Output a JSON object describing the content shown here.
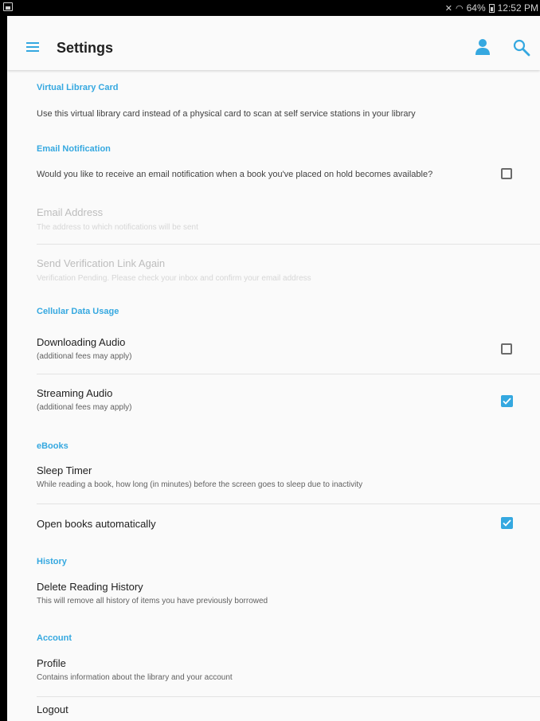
{
  "status_bar": {
    "battery": "64%",
    "time": "12:52 PM"
  },
  "app_bar": {
    "title": "Settings"
  },
  "sections": {
    "virtual_card": {
      "header": "Virtual Library Card",
      "description": "Use this virtual library card instead of a physical card to scan at self service stations in your library"
    },
    "email_notification": {
      "header": "Email Notification",
      "question": "Would you like to receive an email notification when a book you've placed on hold becomes available?",
      "checked": false,
      "email_address_title": "Email Address",
      "email_address_sub": "The address to which notifications will be sent",
      "verification_title": "Send Verification Link Again",
      "verification_sub": "Verification Pending. Please check your inbox and confirm your email address"
    },
    "cellular": {
      "header": "Cellular Data Usage",
      "downloading_title": "Downloading Audio",
      "downloading_sub": "(additional fees may apply)",
      "downloading_checked": false,
      "streaming_title": "Streaming Audio",
      "streaming_sub": "(additional fees may apply)",
      "streaming_checked": true
    },
    "ebooks": {
      "header": "eBooks",
      "sleep_title": "Sleep Timer",
      "sleep_sub": "While reading a book, how long (in minutes) before the screen goes to sleep due to inactivity",
      "open_title": "Open books automatically",
      "open_checked": true
    },
    "history": {
      "header": "History",
      "delete_title": "Delete Reading History",
      "delete_sub": "This will remove all history of items you have previously borrowed"
    },
    "account": {
      "header": "Account",
      "profile_title": "Profile",
      "profile_sub": "Contains information about the library and your account",
      "logout_title": "Logout"
    }
  },
  "colors": {
    "accent": "#35a8e0",
    "background": "#fafafa"
  },
  "icons": {
    "menu": "hamburger-menu-icon",
    "profile": "person-icon",
    "search": "search-icon"
  }
}
